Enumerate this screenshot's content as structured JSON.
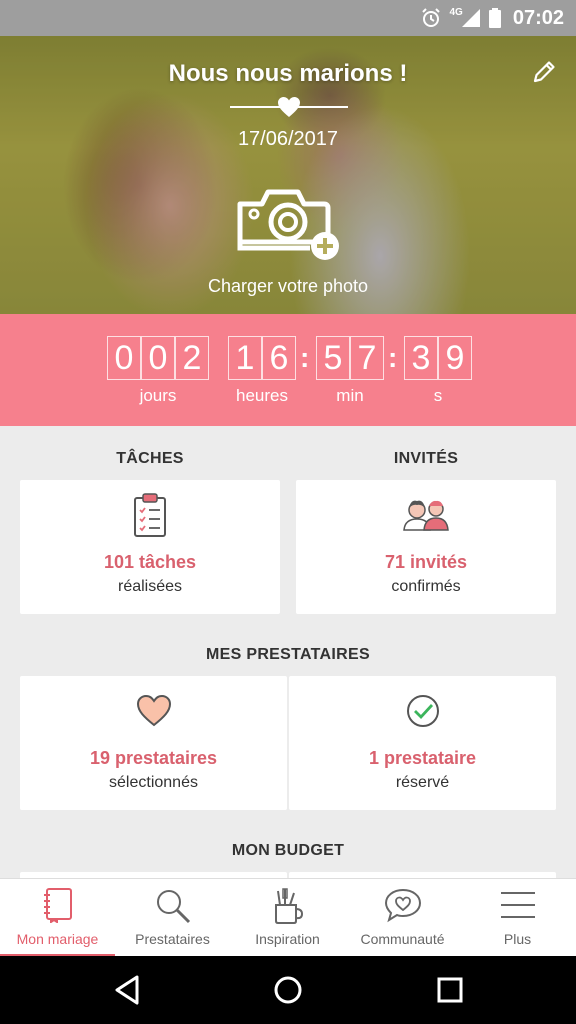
{
  "status_bar": {
    "time": "07:02",
    "network": "4G",
    "icons": [
      "alarm-icon",
      "signal-icon",
      "battery-icon"
    ]
  },
  "hero": {
    "title": "Nous nous marions !",
    "date": "17/06/2017",
    "upload_label": "Charger votre photo"
  },
  "countdown": {
    "days_digits": [
      "0",
      "0",
      "2"
    ],
    "hours_digits": [
      "1",
      "6"
    ],
    "min_digits": [
      "5",
      "7"
    ],
    "sec_digits": [
      "3",
      "9"
    ],
    "separator": ":",
    "labels": {
      "days": "jours",
      "hours": "heures",
      "min": "min",
      "sec": "s"
    }
  },
  "tasks": {
    "title": "TÂCHES",
    "value": "101 tâches",
    "sub": "réalisées"
  },
  "guests": {
    "title": "INVITÉS",
    "value": "71 invités",
    "sub": "confirmés"
  },
  "vendors": {
    "title": "MES PRESTATAIRES",
    "selected": {
      "value": "19 prestataires",
      "sub": "sélectionnés"
    },
    "booked": {
      "value": "1 prestataire",
      "sub": "réservé"
    }
  },
  "budget": {
    "title": "MON BUDGET"
  },
  "tabs": [
    {
      "label": "Mon mariage",
      "icon": "notebook-icon",
      "active": true
    },
    {
      "label": "Prestataires",
      "icon": "search-icon",
      "active": false
    },
    {
      "label": "Inspiration",
      "icon": "pencil-cup-icon",
      "active": false
    },
    {
      "label": "Communauté",
      "icon": "chat-heart-icon",
      "active": false
    },
    {
      "label": "Plus",
      "icon": "menu-icon",
      "active": false
    }
  ],
  "colors": {
    "accent": "#f6808d",
    "accent_text": "#d9616e",
    "tab_active": "#e25e6b",
    "background": "#ececec"
  }
}
